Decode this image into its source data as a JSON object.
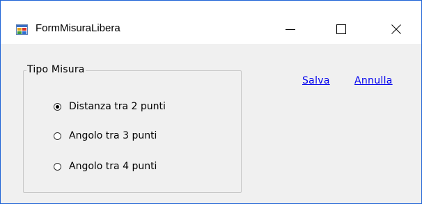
{
  "window": {
    "title": "FormMisuraLibera",
    "icon": "windows-form-icon",
    "controls": [
      "minimize-icon",
      "maximize-icon",
      "close-icon"
    ]
  },
  "group": {
    "label": "Tipo Misura",
    "options": [
      {
        "label": "Distanza tra 2 punti",
        "checked": true
      },
      {
        "label": "Angolo tra 3 punti",
        "checked": false
      },
      {
        "label": "Angolo tra 4 punti",
        "checked": false
      }
    ]
  },
  "actions": {
    "save_label": "Salva",
    "cancel_label": "Annulla"
  },
  "colors": {
    "window_border": "#1e63d6",
    "link": "#0000ee",
    "client_background": "#f0f0f0"
  }
}
